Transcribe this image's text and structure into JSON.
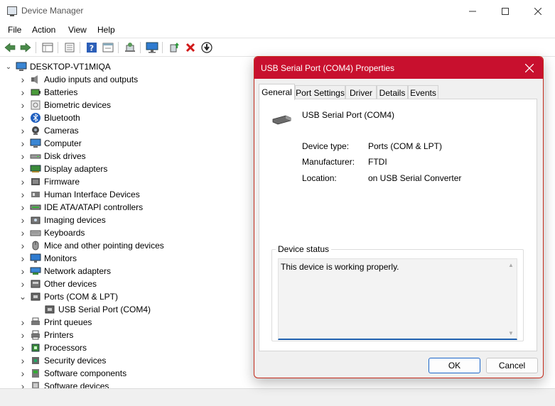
{
  "window": {
    "title": "Device Manager",
    "controls": [
      "minimize",
      "maximize",
      "close"
    ]
  },
  "menu": [
    "File",
    "Action",
    "View",
    "Help"
  ],
  "toolbar": {
    "buttons": [
      "back-icon",
      "forward-icon",
      "properties-grid-icon",
      "list-icon",
      "help-icon",
      "show-icon",
      "scan-icon",
      "monitor-icon",
      "update-driver-icon",
      "uninstall-icon",
      "disable-icon"
    ]
  },
  "tree": {
    "root": "DESKTOP-VT1MIQA",
    "items": [
      {
        "label": "Audio inputs and outputs",
        "icon": "speaker-icon",
        "expanded": false
      },
      {
        "label": "Batteries",
        "icon": "battery-icon",
        "expanded": false
      },
      {
        "label": "Biometric devices",
        "icon": "biometric-icon",
        "expanded": false
      },
      {
        "label": "Bluetooth",
        "icon": "bluetooth-icon",
        "expanded": false
      },
      {
        "label": "Cameras",
        "icon": "camera-icon",
        "expanded": false
      },
      {
        "label": "Computer",
        "icon": "computer-icon",
        "expanded": false
      },
      {
        "label": "Disk drives",
        "icon": "disk-icon",
        "expanded": false
      },
      {
        "label": "Display adapters",
        "icon": "display-adapter-icon",
        "expanded": false
      },
      {
        "label": "Firmware",
        "icon": "firmware-icon",
        "expanded": false
      },
      {
        "label": "Human Interface Devices",
        "icon": "hid-icon",
        "expanded": false
      },
      {
        "label": "IDE ATA/ATAPI controllers",
        "icon": "ide-icon",
        "expanded": false
      },
      {
        "label": "Imaging devices",
        "icon": "imaging-icon",
        "expanded": false
      },
      {
        "label": "Keyboards",
        "icon": "keyboard-icon",
        "expanded": false
      },
      {
        "label": "Mice and other pointing devices",
        "icon": "mouse-icon",
        "expanded": false
      },
      {
        "label": "Monitors",
        "icon": "monitor-icon",
        "expanded": false
      },
      {
        "label": "Network adapters",
        "icon": "network-icon",
        "expanded": false
      },
      {
        "label": "Other devices",
        "icon": "other-devices-icon",
        "expanded": false
      },
      {
        "label": "Ports (COM & LPT)",
        "icon": "port-icon",
        "expanded": true,
        "children": [
          "USB Serial Port (COM4)"
        ]
      },
      {
        "label": "Print queues",
        "icon": "print-queue-icon",
        "expanded": false
      },
      {
        "label": "Printers",
        "icon": "printer-icon",
        "expanded": false
      },
      {
        "label": "Processors",
        "icon": "processor-icon",
        "expanded": false
      },
      {
        "label": "Security devices",
        "icon": "security-icon",
        "expanded": false
      },
      {
        "label": "Software components",
        "icon": "software-component-icon",
        "expanded": false
      },
      {
        "label": "Software devices",
        "icon": "software-device-icon",
        "expanded": false
      }
    ]
  },
  "dialog": {
    "title": "USB Serial Port (COM4) Properties",
    "tabs": [
      "General",
      "Port Settings",
      "Driver",
      "Details",
      "Events"
    ],
    "active_tab": "General",
    "device_name": "USB Serial Port (COM4)",
    "fields": [
      {
        "label": "Device type:",
        "value": "Ports (COM & LPT)"
      },
      {
        "label": "Manufacturer:",
        "value": "FTDI"
      },
      {
        "label": "Location:",
        "value": "on USB Serial Converter"
      }
    ],
    "status_group_label": "Device status",
    "status_text": "This device is working properly.",
    "ok_label": "OK",
    "cancel_label": "Cancel"
  },
  "colors": {
    "dialog_title_bar": "#c8102e",
    "accent": "#1a64c8"
  }
}
